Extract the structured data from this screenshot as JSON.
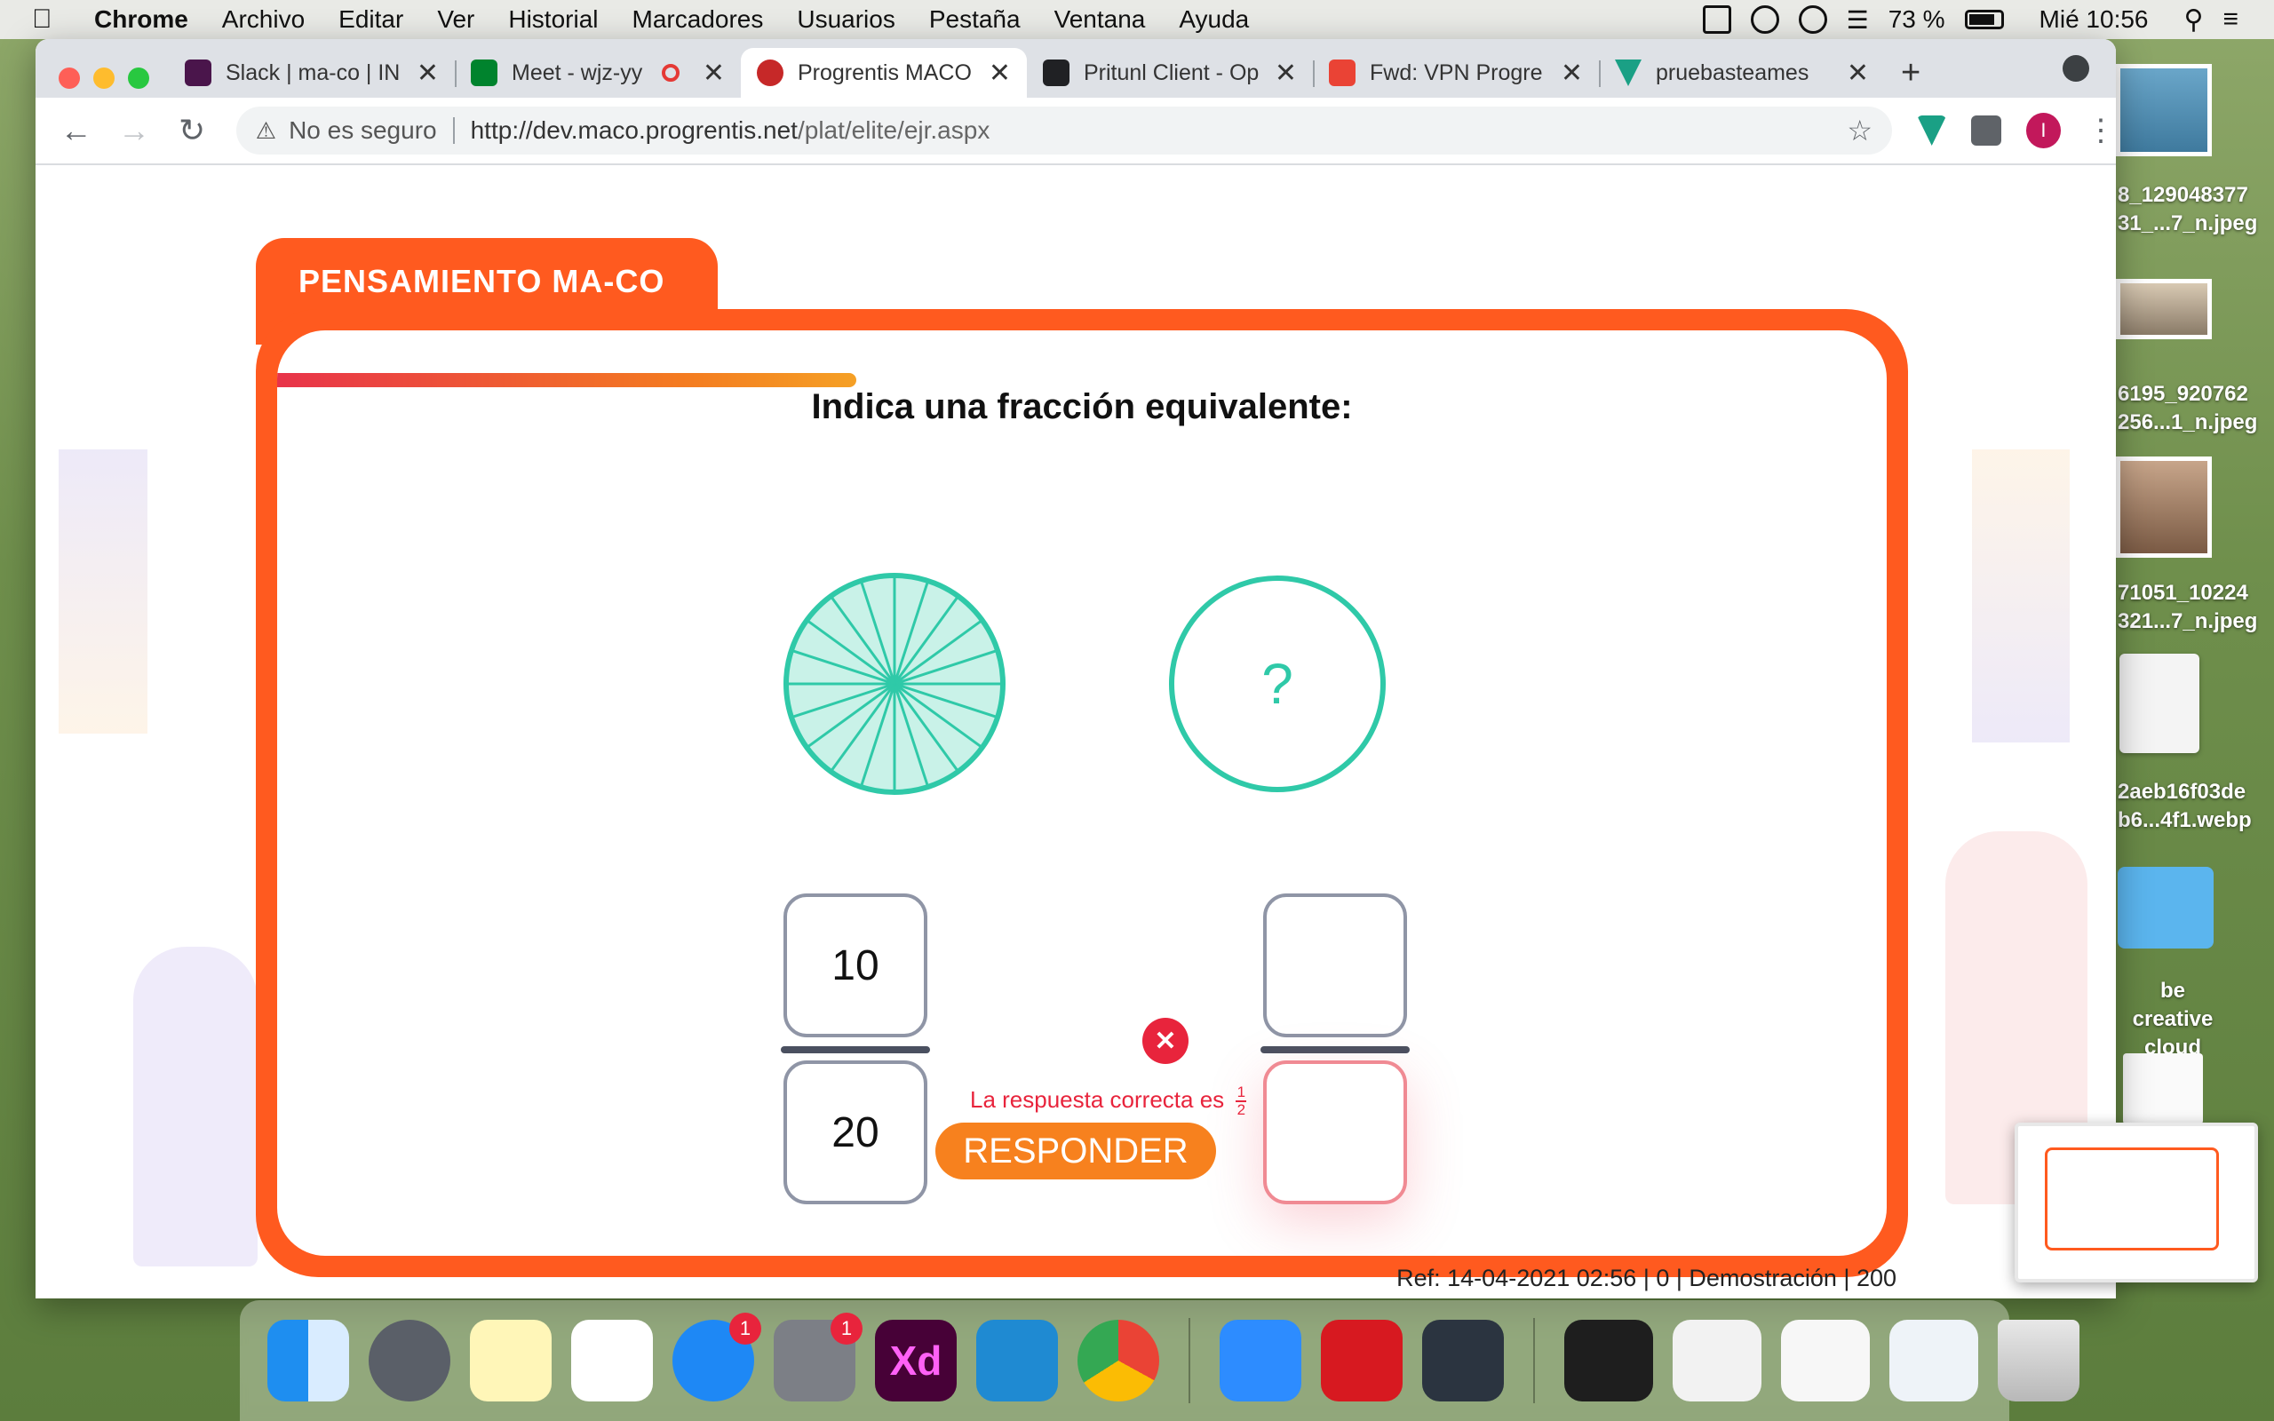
{
  "menubar": {
    "app": "Chrome",
    "items": [
      "Archivo",
      "Editar",
      "Ver",
      "Historial",
      "Marcadores",
      "Usuarios",
      "Pestaña",
      "Ventana",
      "Ayuda"
    ],
    "battery": "73 %",
    "clock": "Mié 10:56"
  },
  "tabs": [
    {
      "title": "Slack | ma-co | IN",
      "favicon": "slack-icon",
      "color": "#4a154b"
    },
    {
      "title": "Meet - wjz-yy",
      "favicon": "meet-icon",
      "color": "#00832d"
    },
    {
      "title": "Progrentis MACO",
      "favicon": "progrentis-icon",
      "color": "#c62828"
    },
    {
      "title": "Pritunl Client - Op",
      "favicon": "pritunl-icon",
      "color": "#202124"
    },
    {
      "title": "Fwd: VPN Progre",
      "favicon": "gmail-icon",
      "color": "#ea4335"
    },
    {
      "title": "pruebasteames",
      "favicon": "vuetify-icon",
      "color": "#1aa085"
    }
  ],
  "address": {
    "security": "No es seguro",
    "url_host": "http://dev.maco.progrentis.net",
    "url_path": "/plat/elite/ejr.aspx"
  },
  "exercise": {
    "header": "PENSAMIENTO MA-CO",
    "question": "Indica una fracción equivalente:",
    "unknown_symbol": "?",
    "left_fraction": {
      "numerator": "10",
      "denominator": "20"
    },
    "right_fraction": {
      "numerator": "",
      "denominator": ""
    },
    "feedback_text": "La respuesta correcta es",
    "feedback_fraction": {
      "numerator": "1",
      "denominator": "2"
    },
    "submit_label": "RESPONDER",
    "wheel_segments": 20,
    "progress": 0.36,
    "accent": "#ff5a1f",
    "teal": "#2fc9a8"
  },
  "footer": {
    "ref": "Ref: 14-04-2021 02:56 | 0 | Demostración | 200"
  },
  "desktop": {
    "files": [
      {
        "line1": "8_129048377",
        "line2": "31_...7_n.jpeg"
      },
      {
        "line1": "6195_920762",
        "line2": "256...1_n.jpeg"
      },
      {
        "line1": "71051_10224",
        "line2": "321...7_n.jpeg"
      },
      {
        "line1": "2aeb16f03de",
        "line2": "b6...4f1.webp"
      },
      {
        "line1": "be creative",
        "line2": "cloud"
      }
    ]
  },
  "dock": {
    "badges": {
      "appstore": "1",
      "prefs": "1"
    }
  }
}
